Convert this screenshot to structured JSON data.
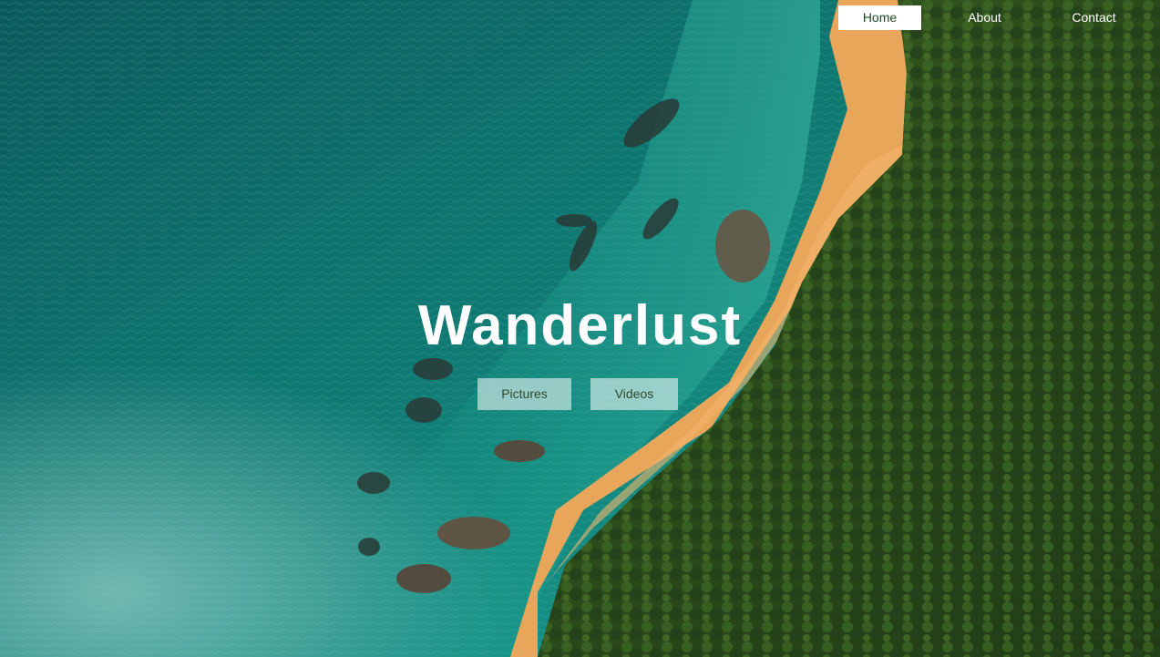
{
  "nav": {
    "items": [
      {
        "label": "Home",
        "active": true
      },
      {
        "label": "About",
        "active": false
      },
      {
        "label": "Contact",
        "active": false
      }
    ]
  },
  "hero": {
    "title": "Wanderlust",
    "buttons": [
      {
        "label": "Pictures"
      },
      {
        "label": "Videos"
      }
    ]
  },
  "colors": {
    "ocean": "#0e6f6c",
    "sand": "#e9a95a",
    "forest": "#2e4f1d",
    "nav_active_text": "#1f4a22"
  }
}
